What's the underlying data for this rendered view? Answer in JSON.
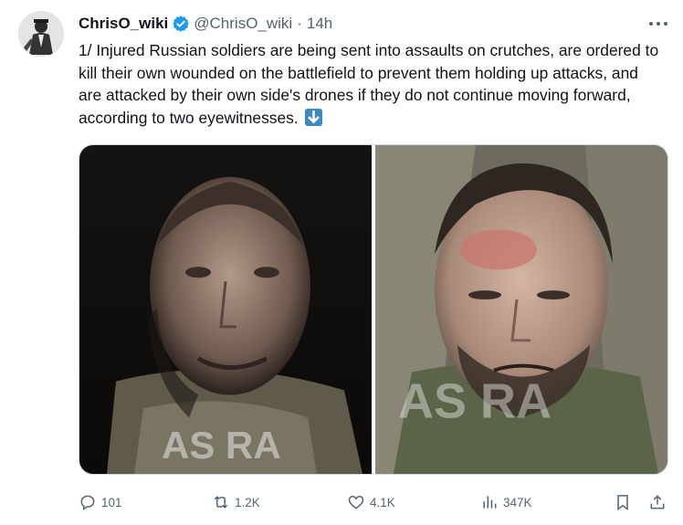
{
  "author": {
    "display_name": "ChrisO_wiki",
    "handle": "@ChrisO_wiki",
    "separator": "·",
    "timestamp": "14h",
    "verified": true
  },
  "tweet": {
    "text": "1/ Injured Russian soldiers are being sent into assaults on crutches, are ordered to kill their own wounded on the battlefield to prevent them holding up attacks, and are attacked by their own side's drones if they do not continue moving forward, according to two eyewitnesses."
  },
  "media": {
    "watermark_left": "AS RA",
    "watermark_right": "AS RA"
  },
  "actions": {
    "replies": "101",
    "reposts": "1.2K",
    "likes": "4.1K",
    "views": "347K"
  },
  "colors": {
    "text_primary": "#0f1419",
    "text_secondary": "#536471",
    "verified_blue": "#1d9bf0",
    "emoji_blue": "#3b88c3"
  },
  "icons": [
    "more-icon",
    "verified-badge-icon",
    "down-arrow-emoji-icon",
    "reply-icon",
    "repost-icon",
    "like-icon",
    "views-icon",
    "bookmark-icon",
    "share-icon"
  ]
}
